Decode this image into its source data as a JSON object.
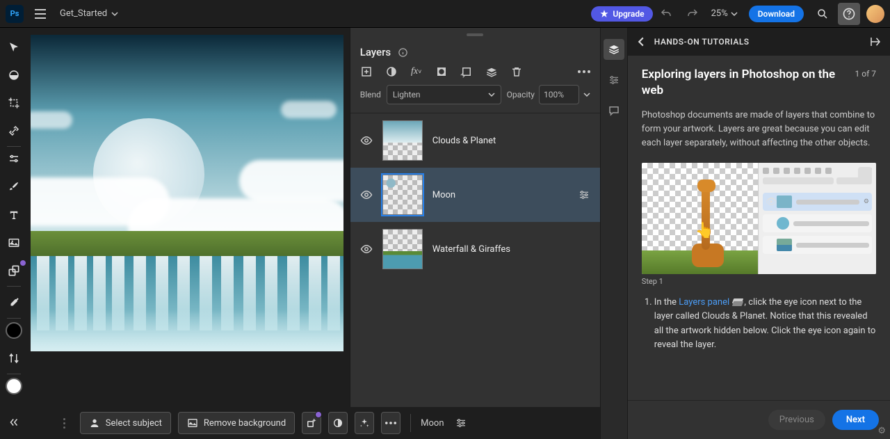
{
  "topbar": {
    "app": "Ps",
    "doc_title": "Get_Started",
    "upgrade": "Upgrade",
    "zoom": "25%",
    "download": "Download"
  },
  "tools": [
    {
      "n": "move-tool"
    },
    {
      "n": "blur-tool"
    },
    {
      "n": "crop-tool"
    },
    {
      "n": "heal-tool"
    },
    {
      "n": "adjust-tool"
    },
    {
      "n": "brush-tool"
    },
    {
      "n": "type-tool"
    },
    {
      "n": "image-tool"
    },
    {
      "n": "clone-tool"
    },
    {
      "n": "eyedropper-tool"
    }
  ],
  "layers_panel": {
    "title": "Layers",
    "blend_label": "Blend",
    "blend_value": "Lighten",
    "opacity_label": "Opacity",
    "opacity_value": "100%",
    "layers": [
      {
        "name": "Clouds & Planet",
        "selected": false
      },
      {
        "name": "Moon",
        "selected": true
      },
      {
        "name": "Waterfall & Giraffes",
        "selected": false
      }
    ]
  },
  "bottombar": {
    "select_subject": "Select subject",
    "remove_bg": "Remove background",
    "context_label": "Moon"
  },
  "tutorial": {
    "header": "HANDS-ON TUTORIALS",
    "title": "Exploring layers in Photoshop on the web",
    "count": "1 of 7",
    "desc": "Photoshop documents are made of layers that combine to form your artwork. Layers are great because you can edit each layer separately, without affecting the other objects.",
    "step_label": "Step 1",
    "step_prefix": "In the ",
    "step_link": "Layers panel",
    "step_rest": ", click the eye icon next to the layer called Clouds & Planet. Notice that this revealed all the artwork hidden below. Click the eye icon again to reveal the layer.",
    "prev": "Previous",
    "next": "Next"
  }
}
